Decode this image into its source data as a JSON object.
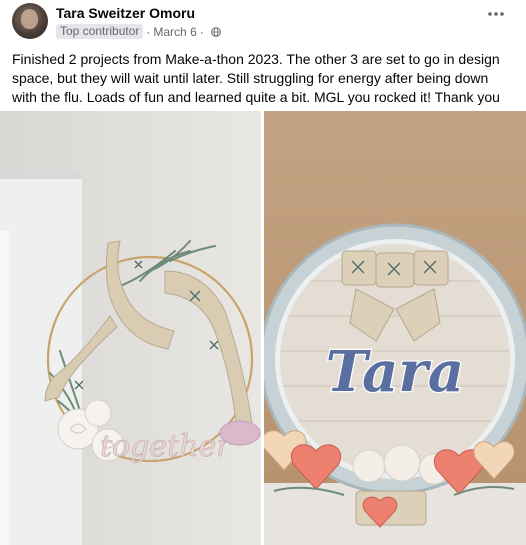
{
  "post": {
    "author": "Tara Sweitzer Omoru",
    "badge": "Top contributor",
    "separator": "·",
    "date": "March 6",
    "separator2": "·",
    "audience_icon": "globe-icon",
    "more_icon": "more-options-icon",
    "text": "Finished 2 projects from Make-a-thon 2023. The other 3 are set to go in design space, but they will wait until later. Still struggling for energy after being down with the flu. Loads of fun and learned quite a bit. MGL you rocked it! Thank you"
  },
  "photos": {
    "left_sign": "together",
    "right_sign": "Tara"
  }
}
